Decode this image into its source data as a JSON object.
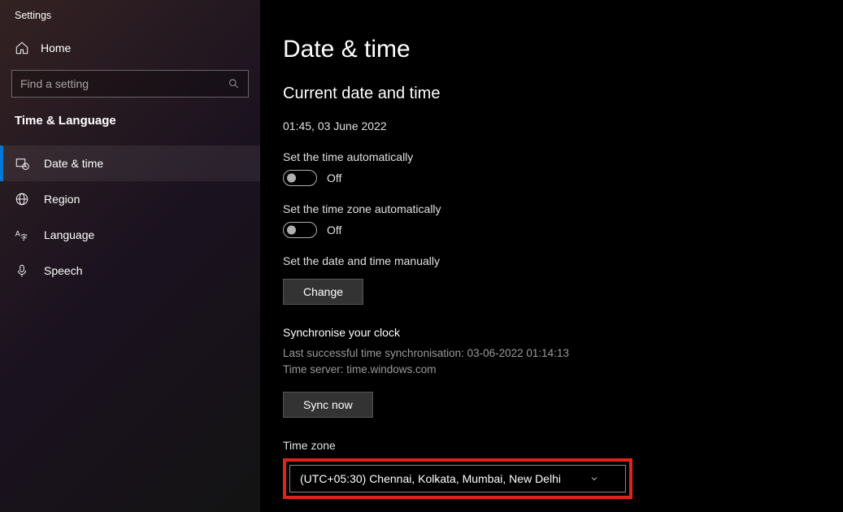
{
  "app": {
    "title": "Settings"
  },
  "sidebar": {
    "home": "Home",
    "search_placeholder": "Find a setting",
    "section": "Time & Language",
    "items": [
      {
        "label": "Date & time"
      },
      {
        "label": "Region"
      },
      {
        "label": "Language"
      },
      {
        "label": "Speech"
      }
    ]
  },
  "page": {
    "title": "Date & time",
    "current": {
      "heading": "Current date and time",
      "value": "01:45, 03 June 2022"
    },
    "auto_time": {
      "label": "Set the time automatically",
      "state": "Off"
    },
    "auto_tz": {
      "label": "Set the time zone automatically",
      "state": "Off"
    },
    "manual": {
      "label": "Set the date and time manually",
      "button": "Change"
    },
    "sync": {
      "heading": "Synchronise your clock",
      "last": "Last successful time synchronisation: 03-06-2022 01:14:13",
      "server": "Time server: time.windows.com",
      "button": "Sync now"
    },
    "tz": {
      "label": "Time zone",
      "selected": "(UTC+05:30) Chennai, Kolkata, Mumbai, New Delhi"
    }
  }
}
